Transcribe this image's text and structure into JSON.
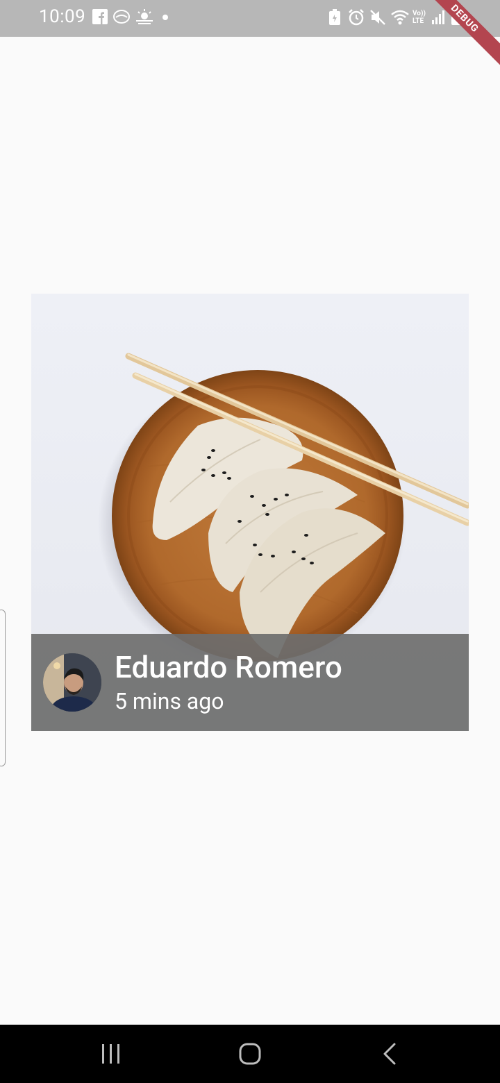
{
  "status_bar": {
    "time": "10:09",
    "debug_label": "DEBUG",
    "left_icons": [
      "facebook-icon",
      "app-icon",
      "weather-icon",
      "dot-icon"
    ],
    "right_icons": [
      "battery-saver-icon",
      "alarm-icon",
      "mute-icon",
      "wifi-icon",
      "volte-icon",
      "signal-icon",
      "battery-icon"
    ],
    "volte_text": "Vo)) LTE"
  },
  "card": {
    "image": "dumplings-on-wooden-plate-with-chopsticks",
    "author_name": "Eduardo Romero",
    "time_ago": "5 mins ago"
  },
  "nav_bar": {
    "buttons": [
      "recent-apps-icon",
      "home-icon",
      "back-icon"
    ]
  },
  "colors": {
    "background": "#fafafa",
    "status_bar": "#b7b7b7",
    "overlay": "#6e6e6e",
    "nav_bar": "#000000",
    "debug_ribbon": "#b3454f"
  }
}
